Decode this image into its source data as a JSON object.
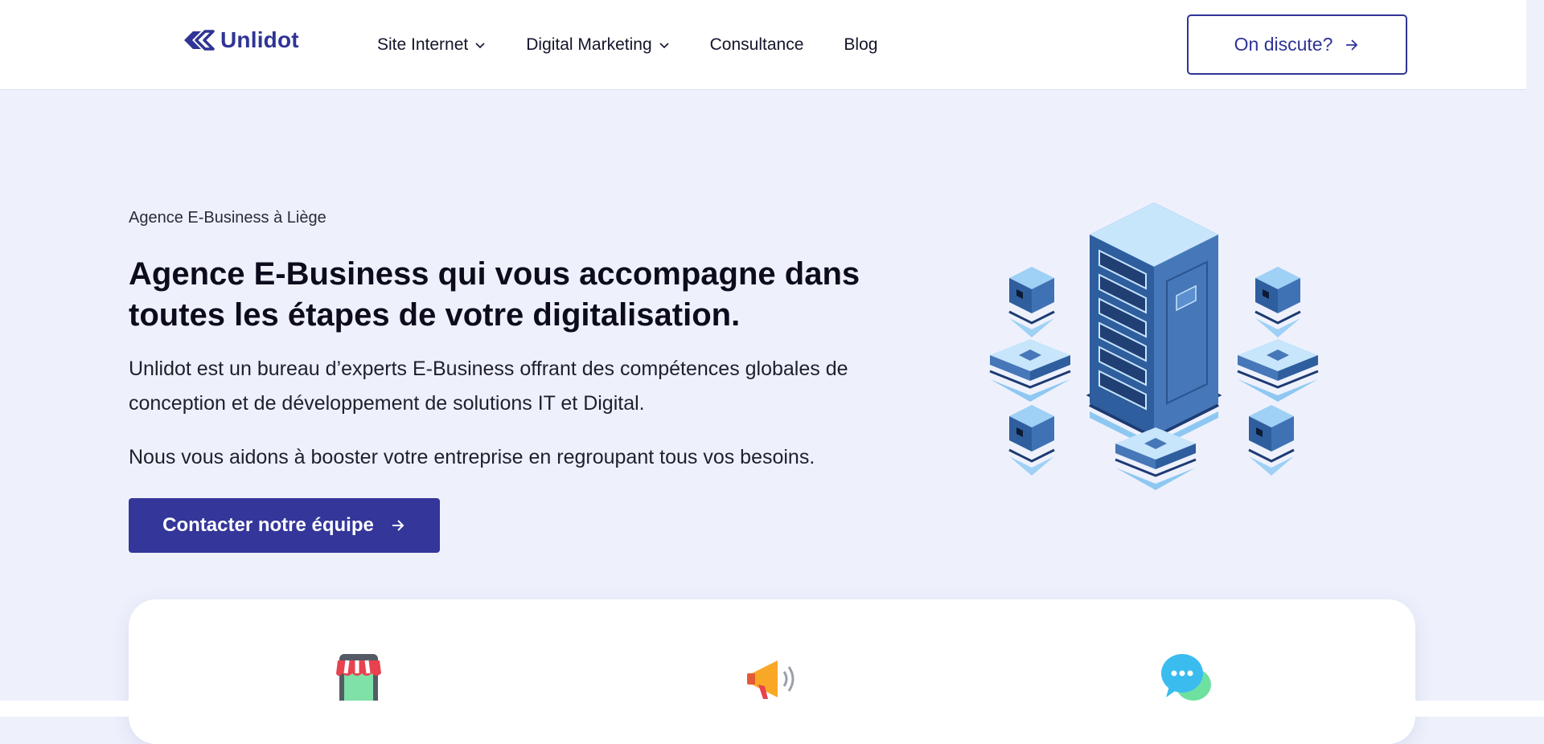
{
  "header": {
    "logo_text": "Unlidot",
    "nav": [
      {
        "label": "Site Internet",
        "has_dropdown": true
      },
      {
        "label": "Digital Marketing",
        "has_dropdown": true
      },
      {
        "label": "Consultance",
        "has_dropdown": false
      },
      {
        "label": "Blog",
        "has_dropdown": false
      }
    ],
    "cta_label": "On discute?"
  },
  "hero": {
    "eyebrow": "Agence E-Business à Liège",
    "title": "Agence E-Business qui vous accompagne dans toutes les étapes de votre digitalisation.",
    "description": "Unlidot est un bureau d’experts E-Business offrant des compétences globales de conception et de développement de solutions IT et Digital.",
    "description2": "Nous vous aidons à booster votre entreprise en regroupant tous vos besoins.",
    "cta_label": "Contacter notre équipe",
    "illustration": "server-rack-illustration"
  },
  "features": {
    "icons": [
      "storefront-tablet-icon",
      "megaphone-icon",
      "chat-bubbles-icon"
    ]
  },
  "colors": {
    "brand": "#2f3496",
    "button": "#34369a",
    "hero_background": "#eef1fc",
    "text": "#14142b"
  }
}
